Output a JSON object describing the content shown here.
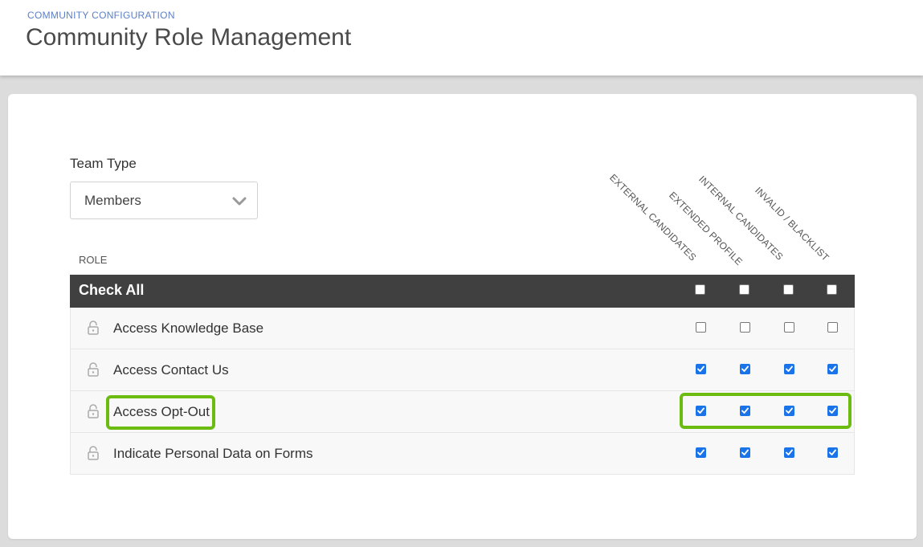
{
  "header": {
    "breadcrumb": "COMMUNITY CONFIGURATION",
    "title": "Community Role Management"
  },
  "team_type": {
    "label": "Team Type",
    "selected": "Members"
  },
  "table": {
    "role_label": "ROLE",
    "check_all_label": "Check All",
    "columns": [
      "EXTERNAL CANDIDATES",
      "EXTENDED PROFILE",
      "INTERNAL CANDIDATES",
      "INVALID / BLACKLIST"
    ],
    "check_all_states": [
      false,
      false,
      false,
      false
    ],
    "rows": [
      {
        "label": "Access Knowledge Base",
        "checks": [
          false,
          false,
          false,
          false
        ]
      },
      {
        "label": "Access Contact Us",
        "checks": [
          true,
          true,
          true,
          true
        ]
      },
      {
        "label": "Access Opt-Out",
        "checks": [
          true,
          true,
          true,
          true
        ]
      },
      {
        "label": "Indicate Personal Data on Forms",
        "checks": [
          true,
          true,
          true,
          true
        ]
      }
    ]
  },
  "colors": {
    "highlight": "#6cbb10",
    "checkbox_checked": "#1a73e8",
    "header_bar": "#404040"
  },
  "icons": {
    "lock": "lock-icon",
    "chevron": "chevron-down-icon"
  }
}
